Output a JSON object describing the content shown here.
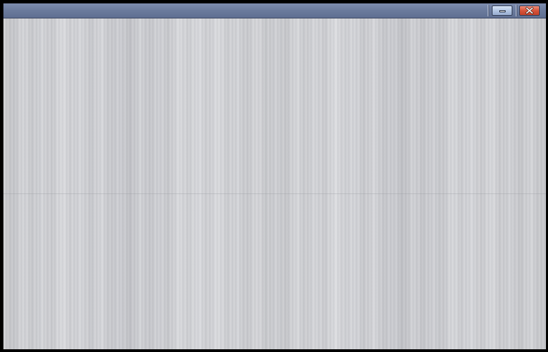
{
  "window": {
    "title": "",
    "controls": {
      "minimize_icon": "minimize-icon",
      "close_icon": "close-icon"
    }
  },
  "colors": {
    "titlebar": "#6a7a9c",
    "minimize_button": "#b3c6e3",
    "close_button": "#d7543a",
    "background": "#d0d1d5"
  }
}
